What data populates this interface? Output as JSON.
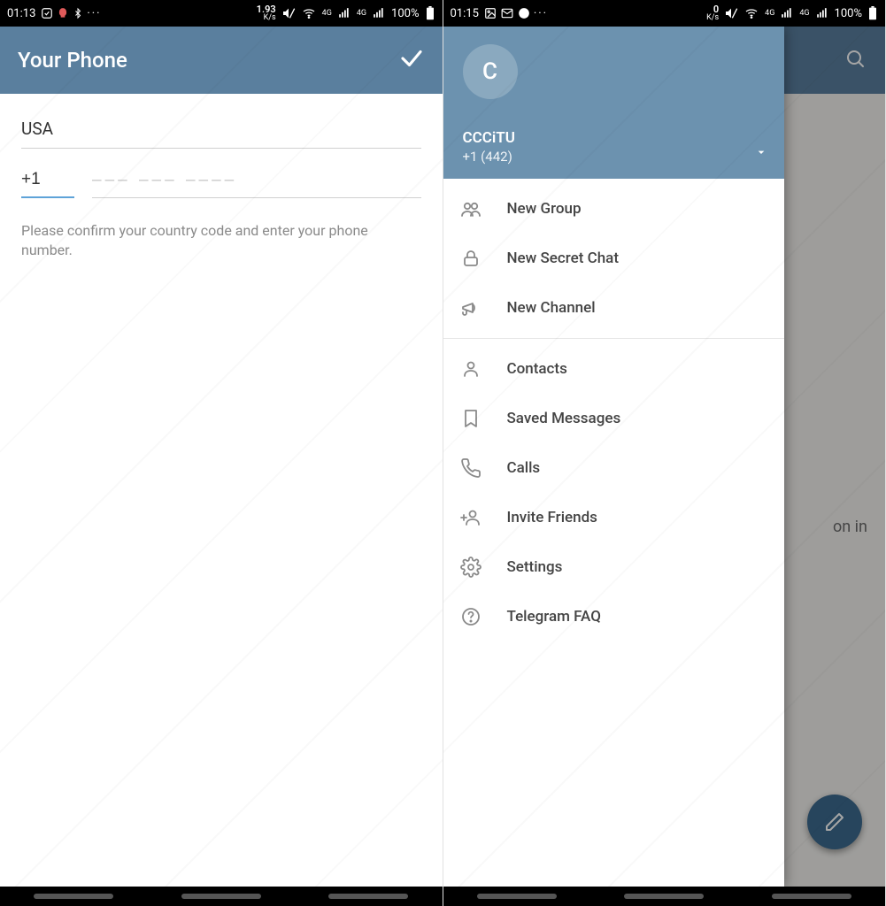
{
  "left": {
    "status": {
      "time": "01:13",
      "kbps": "1.93",
      "kbps_unit": "K/s",
      "net": "4G",
      "battery": "100%"
    },
    "appbar": {
      "title": "Your Phone"
    },
    "login": {
      "country": "USA",
      "code": "+1",
      "placeholder": "––– ––– ––––",
      "hint": "Please confirm your country code and enter your phone number."
    }
  },
  "right": {
    "status": {
      "time": "01:15",
      "kbps": "0",
      "kbps_unit": "K/s",
      "net": "4G",
      "battery": "100%"
    },
    "bg_text": "on in",
    "drawer": {
      "avatar_letter": "C",
      "username": "CCCiTU",
      "phone": "+1 (442)",
      "menu": [
        {
          "icon": "group",
          "label": "New Group"
        },
        {
          "icon": "lock",
          "label": "New Secret Chat"
        },
        {
          "icon": "megaphone",
          "label": "New Channel"
        },
        {
          "sep": true
        },
        {
          "icon": "person",
          "label": "Contacts"
        },
        {
          "icon": "bookmark",
          "label": "Saved Messages"
        },
        {
          "icon": "call",
          "label": "Calls"
        },
        {
          "icon": "invite",
          "label": "Invite Friends"
        },
        {
          "icon": "gear",
          "label": "Settings"
        },
        {
          "icon": "help",
          "label": "Telegram FAQ"
        }
      ]
    }
  }
}
